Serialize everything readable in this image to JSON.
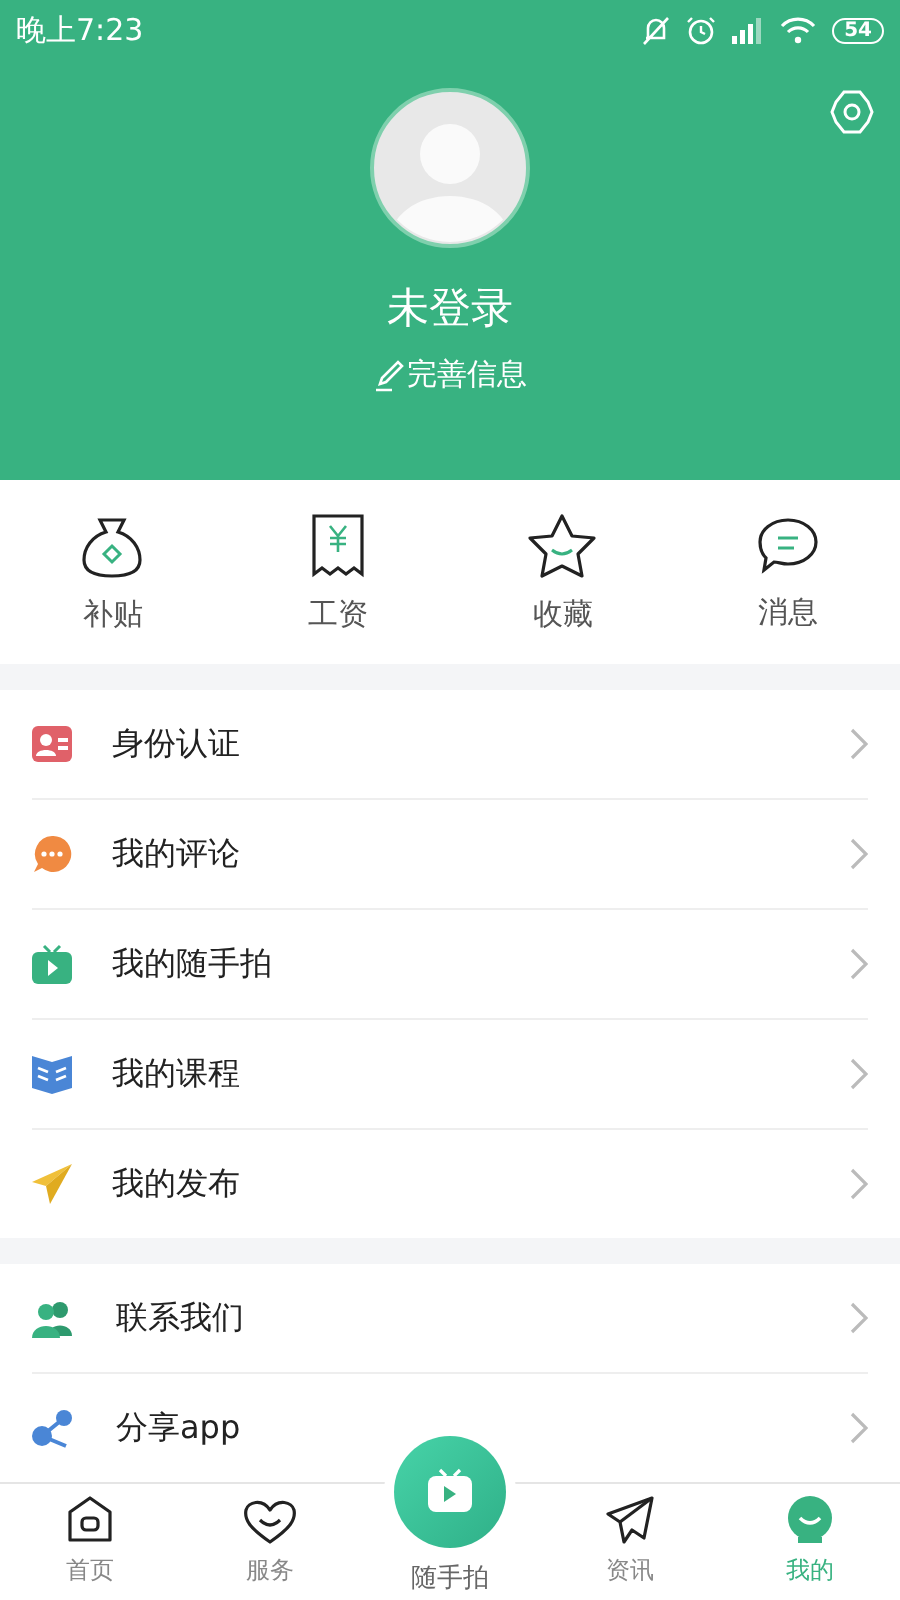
{
  "status_bar": {
    "time": "晚上7:23",
    "battery": "54"
  },
  "profile": {
    "name": "未登录",
    "edit_link": "完善信息"
  },
  "shortcuts": [
    {
      "kind": "bag",
      "label": "补贴"
    },
    {
      "kind": "receipt",
      "label": "工资"
    },
    {
      "kind": "star",
      "label": "收藏"
    },
    {
      "kind": "chat",
      "label": "消息"
    }
  ],
  "menu_groups": [
    [
      {
        "kind": "id-card",
        "label": "身份认证"
      },
      {
        "kind": "comment",
        "label": "我的评论"
      },
      {
        "kind": "tv",
        "label": "我的随手拍"
      },
      {
        "kind": "book",
        "label": "我的课程"
      },
      {
        "kind": "plane",
        "label": "我的发布"
      }
    ],
    [
      {
        "kind": "people",
        "label": "联系我们"
      },
      {
        "kind": "share",
        "label": "分享app"
      }
    ]
  ],
  "tab_bar": [
    {
      "kind": "home",
      "label": "首页",
      "selected": false
    },
    {
      "kind": "heart",
      "label": "服务",
      "selected": false
    },
    {
      "kind": "center",
      "label": "随手拍",
      "selected": false
    },
    {
      "kind": "send",
      "label": "资讯",
      "selected": false
    },
    {
      "kind": "face",
      "label": "我的",
      "selected": true
    }
  ]
}
